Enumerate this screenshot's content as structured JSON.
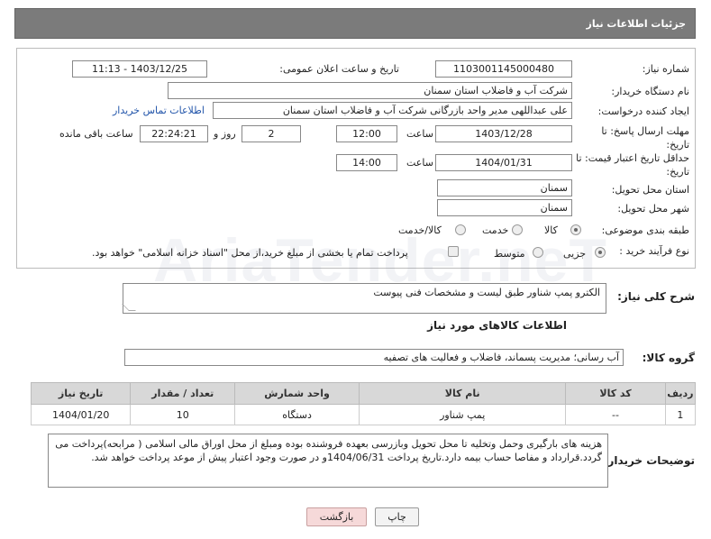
{
  "header": {
    "title": "جزئیات اطلاعات نیاز"
  },
  "form": {
    "need_number_label": "شماره نیاز:",
    "need_number": "1103001145000480",
    "announce_label": "تاریخ و ساعت اعلان عمومی:",
    "announce_value": "1403/12/25 - 11:13",
    "buyer_label": "نام دستگاه خریدار:",
    "buyer_value": "شرکت آب و فاضلاب استان سمنان",
    "creator_label": "ایجاد کننده درخواست:",
    "creator_value": "علی عبداللهی مدیر واحد بازرگانی شرکت آب و فاضلاب استان سمنان",
    "contact_link": "اطلاعات تماس خریدار",
    "deadline_label": "مهلت ارسال پاسخ: تا تاریخ:",
    "deadline_date": "1403/12/28",
    "time_label": "ساعت",
    "deadline_time": "12:00",
    "days_value": "2",
    "days_label": "روز و",
    "remaining_time": "22:24:21",
    "remaining_label": "ساعت باقی مانده",
    "validity_label": "حداقل تاریخ اعتبار قیمت: تا تاریخ:",
    "validity_date": "1404/01/31",
    "validity_time": "14:00",
    "province_label": "استان محل تحویل:",
    "province_value": "سمنان",
    "city_label": "شهر محل تحویل:",
    "city_value": "سمنان",
    "category_label": "طبقه بندی موضوعی:",
    "category_options": [
      "کالا",
      "خدمت",
      "کالا/خدمت"
    ],
    "category_selected": "کالا",
    "process_label": "نوع فرآیند خرید :",
    "process_options": [
      "جزیی",
      "متوسط"
    ],
    "process_selected": "جزیی",
    "payment_note": "پرداخت تمام یا بخشی از مبلغ خرید،از محل \"اسناد خزانه اسلامی\" خواهد بود."
  },
  "description": {
    "label": "شرح کلی نیاز:",
    "value": "الکترو پمپ شناور طبق لیست و مشخصات فنی پیوست"
  },
  "goods_section": {
    "title": "اطلاعات کالاهای مورد نیاز",
    "group_label": "گروه کالا:",
    "group_value": "آب رسانی؛ مدیریت پسماند، فاضلاب و فعالیت های تصفیه"
  },
  "table": {
    "headers": [
      "ردیف",
      "کد کالا",
      "نام کالا",
      "واحد شمارش",
      "تعداد / مقدار",
      "تاریخ نیاز"
    ],
    "rows": [
      [
        "1",
        "--",
        "پمپ شناور",
        "دستگاه",
        "10",
        "1404/01/20"
      ]
    ]
  },
  "buyer_notes": {
    "label": "توضیحات خریدار:",
    "value": "هزینه های بارگیری وحمل وتخلیه تا محل تحویل وبازرسی بعهده فروشنده بوده ومبلغ از محل اوراق مالی اسلامی ( مرابحه)پرداخت می گردد.قرارداد و مفاصا حساب بیمه دارد.تاریخ پرداخت 1404/06/31و در صورت وجود اعتبار پیش از موعد پرداخت خواهد شد."
  },
  "buttons": {
    "print": "چاپ",
    "back": "بازگشت"
  },
  "watermark": "AriaTender.neT"
}
